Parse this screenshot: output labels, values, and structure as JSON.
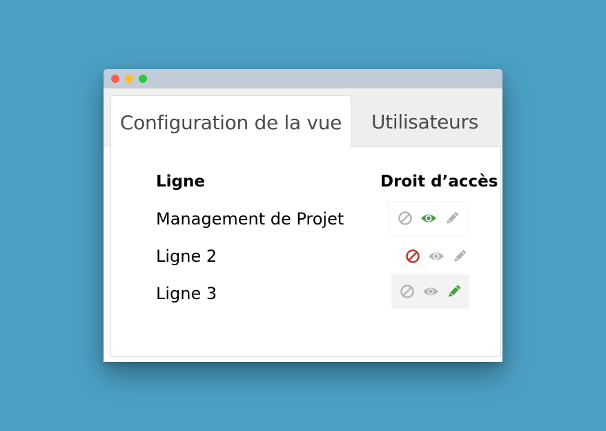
{
  "tabs": [
    {
      "label": "Configuration de la vue",
      "active": true
    },
    {
      "label": "Utilisateurs",
      "active": false
    }
  ],
  "table": {
    "headers": {
      "line": "Ligne",
      "access": "Droit d’accès"
    },
    "rows": [
      {
        "label": "Management de Projet",
        "access": "read"
      },
      {
        "label": "Ligne 2",
        "access": "none"
      },
      {
        "label": "Ligne 3",
        "access": "write"
      }
    ]
  },
  "colors": {
    "desktop": "#4c9fc5",
    "active_green": "#4a9e45",
    "deny_red": "#c9302c",
    "inactive_gray": "#b3b3b3"
  },
  "icons": [
    "ban-icon",
    "eye-icon",
    "pencil-icon"
  ]
}
